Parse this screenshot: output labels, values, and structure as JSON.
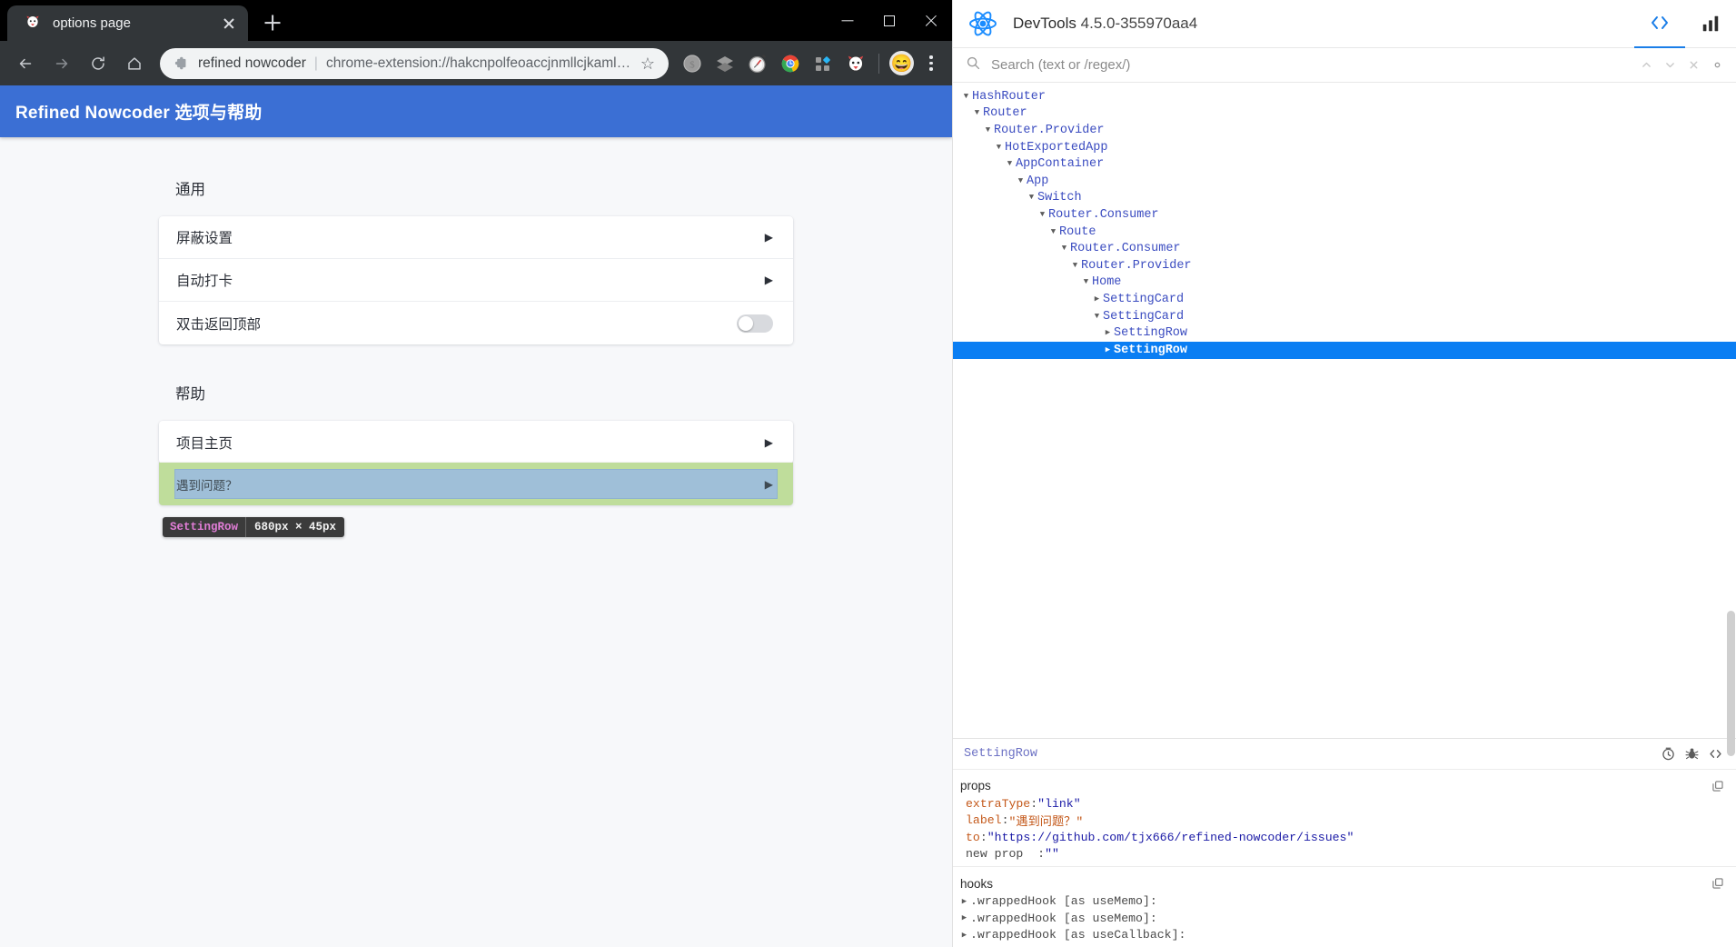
{
  "browser": {
    "tab": {
      "favicon": "nowcoder-cat-favicon",
      "title": "options page",
      "close_label": "×"
    },
    "newtab_label": "+",
    "window_controls": {
      "minimize": "minimize-icon",
      "maximize": "maximize-icon",
      "close": "close-icon"
    },
    "nav": {
      "back": "back-arrow-icon",
      "forward": "forward-arrow-icon",
      "reload": "reload-icon",
      "home": "home-icon"
    },
    "omnibox": {
      "extension_icon": "puzzle-piece-icon",
      "extension_name": "refined nowcoder",
      "separator": "|",
      "url": "chrome-extension://hakcnpolfeoaccjnmllcjkamlekf...",
      "bookmark_star": "☆"
    },
    "toolbar_extensions": [
      {
        "name": "coin-extension-icon"
      },
      {
        "name": "layers-extension-icon"
      },
      {
        "name": "compass-stopwatch-extension-icon"
      },
      {
        "name": "chrome-wheel-extension-icon"
      },
      {
        "name": "grid-blue-extension-icon"
      },
      {
        "name": "nowcoder-cat-extension-icon"
      }
    ],
    "avatar": "😄",
    "menu": "kebab-menu-icon"
  },
  "page": {
    "header_title": "Refined Nowcoder 选项与帮助",
    "header_color": "#3b6fd4",
    "sections": [
      {
        "title": "通用",
        "rows": [
          {
            "label": "屏蔽设置",
            "control": "arrow"
          },
          {
            "label": "自动打卡",
            "control": "arrow"
          },
          {
            "label": "双击返回顶部",
            "control": "toggle",
            "toggle_on": false
          }
        ]
      },
      {
        "title": "帮助",
        "rows": [
          {
            "label": "项目主页",
            "control": "arrow"
          },
          {
            "label": "遇到问题？",
            "control": "arrow",
            "inspected": true
          }
        ]
      }
    ],
    "inspect_badge": {
      "component": "SettingRow",
      "size": "680px × 45px",
      "highlight_color": "#9fbfd8",
      "padding_color": "#bfdd9b"
    },
    "arrow_glyph": "▶"
  },
  "devtools": {
    "logo": "react-atom-logo",
    "title": "DevTools",
    "version": "4.5.0-355970aa4",
    "tabs": [
      {
        "label": "components-tab",
        "icon": "code-brackets-icon",
        "active": true
      },
      {
        "label": "profiler-tab",
        "icon": "bar-chart-icon",
        "active": false
      }
    ],
    "search": {
      "icon": "search-icon",
      "placeholder": "Search (text or /regex/)",
      "value": "",
      "prev": "chevron-up-icon",
      "next": "chevron-down-icon",
      "clear": "close-icon",
      "settings": "gear-icon"
    },
    "tree": [
      {
        "name": "HashRouter",
        "depth": 0,
        "caret": "▼",
        "selected": false
      },
      {
        "name": "Router",
        "depth": 1,
        "caret": "▼",
        "selected": false
      },
      {
        "name": "Router.Provider",
        "depth": 2,
        "caret": "▼",
        "selected": false
      },
      {
        "name": "HotExportedApp",
        "depth": 3,
        "caret": "▼",
        "selected": false
      },
      {
        "name": "AppContainer",
        "depth": 4,
        "caret": "▼",
        "selected": false
      },
      {
        "name": "App",
        "depth": 5,
        "caret": "▼",
        "selected": false
      },
      {
        "name": "Switch",
        "depth": 6,
        "caret": "▼",
        "selected": false
      },
      {
        "name": "Router.Consumer",
        "depth": 7,
        "caret": "▼",
        "selected": false
      },
      {
        "name": "Route",
        "depth": 8,
        "caret": "▼",
        "selected": false
      },
      {
        "name": "Router.Consumer",
        "depth": 9,
        "caret": "▼",
        "selected": false
      },
      {
        "name": "Router.Provider",
        "depth": 10,
        "caret": "▼",
        "selected": false
      },
      {
        "name": "Home",
        "depth": 11,
        "caret": "▼",
        "selected": false
      },
      {
        "name": "SettingCard",
        "depth": 12,
        "caret": "▶",
        "selected": false
      },
      {
        "name": "SettingCard",
        "depth": 12,
        "caret": "▼",
        "selected": false
      },
      {
        "name": "SettingRow",
        "depth": 13,
        "caret": "▶",
        "selected": false
      },
      {
        "name": "SettingRow",
        "depth": 13,
        "caret": "▶",
        "selected": true
      }
    ],
    "inspector": {
      "component_name": "SettingRow",
      "actions": [
        {
          "name": "suspense-timer-icon"
        },
        {
          "name": "bug-icon"
        },
        {
          "name": "view-source-icon"
        }
      ],
      "props_title": "props",
      "props_copy": "copy-icon",
      "props": [
        {
          "key": "extraType",
          "colon": ":",
          "value": "\"link\"",
          "value_type": "string",
          "expandable": false
        },
        {
          "key": "label",
          "colon": ":",
          "value": "\"遇到问题？\"",
          "value_type": "cn-string",
          "expandable": false
        },
        {
          "key": "to",
          "colon": ":",
          "value": "\"https://github.com/tjx666/refined-nowcoder/issues\"",
          "value_type": "string",
          "expandable": false
        },
        {
          "key": "new prop",
          "colon": ":",
          "value": "\"\"",
          "value_type": "empty",
          "expandable": false,
          "plain_key": true
        }
      ],
      "hooks_title": "hooks",
      "hooks_copy": "copy-icon",
      "hooks": [
        {
          "caret": "▶",
          "name": ".wrappedHook [as useMemo]:"
        },
        {
          "caret": "▶",
          "name": ".wrappedHook [as useMemo]:"
        },
        {
          "caret": "▶",
          "name": ".wrappedHook [as useCallback]:"
        }
      ]
    }
  }
}
